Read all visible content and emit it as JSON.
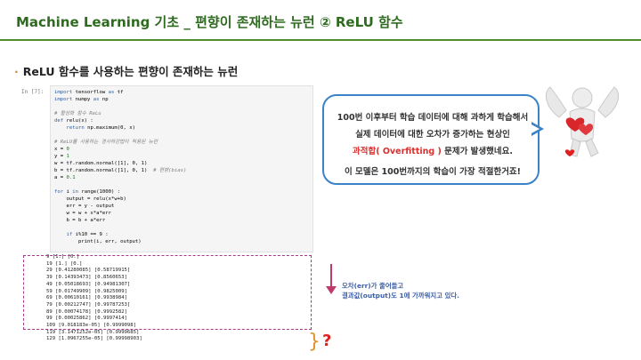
{
  "slide": {
    "title": "Machine Learning 기초 _ 편향이 존재하는 뉴런 ② ReLU 함수",
    "section_bullet": "·",
    "section_heading": "ReLU 함수를 사용하는 편향이 존재하는 뉴런"
  },
  "notebook": {
    "prompt": "In [7]:",
    "code_lines": [
      [
        {
          "t": "import",
          "c": "kw"
        },
        {
          "t": " tensorflow "
        },
        {
          "t": "as",
          "c": "kw"
        },
        {
          "t": " tf"
        }
      ],
      [
        {
          "t": "import",
          "c": "kw"
        },
        {
          "t": " numpy "
        },
        {
          "t": "as",
          "c": "kw"
        },
        {
          "t": " np"
        }
      ],
      [],
      [
        {
          "t": "# 활성화 함수 ReLu",
          "c": "cm"
        }
      ],
      [
        {
          "t": "def",
          "c": "kw"
        },
        {
          "t": " relu(x) :"
        }
      ],
      [
        {
          "t": "    "
        },
        {
          "t": "return",
          "c": "kw"
        },
        {
          "t": " np.maximum(0, x)"
        }
      ],
      [],
      [
        {
          "t": "# ReLU를 사용하는 경사하강법이 적용된 뉴런",
          "c": "cm"
        }
      ],
      [
        {
          "t": "x = "
        },
        {
          "t": "0",
          "c": "nm"
        }
      ],
      [
        {
          "t": "y = "
        },
        {
          "t": "1",
          "c": "nm"
        }
      ],
      [
        {
          "t": "w = tf.random.normal([1], 0, 1)"
        }
      ],
      [
        {
          "t": "b = tf.random.normal([1], 0, 1)  "
        },
        {
          "t": "# 편향(bias)",
          "c": "cm"
        }
      ],
      [
        {
          "t": "a = "
        },
        {
          "t": "0.1",
          "c": "nm"
        }
      ],
      [],
      [
        {
          "t": "for",
          "c": "kw"
        },
        {
          "t": " i "
        },
        {
          "t": "in",
          "c": "kw"
        },
        {
          "t": " range(1000) :"
        }
      ],
      [
        {
          "t": "    output = relu(x*w+b)"
        }
      ],
      [
        {
          "t": "    err = y - output"
        }
      ],
      [
        {
          "t": "    w = w + x*a*err"
        }
      ],
      [
        {
          "t": "    b = b + a*err"
        }
      ],
      [],
      [
        {
          "t": "    "
        },
        {
          "t": "if",
          "c": "kw"
        },
        {
          "t": " i%10 == 9 :"
        }
      ],
      [
        {
          "t": "        print(i, err, output)"
        }
      ]
    ],
    "output_lines": [
      "9 [1.] [0.]",
      "19 [1.] [0.]",
      "29 [0.41280085] [0.58719915]",
      "39 [0.14393473] [0.8560653]",
      "49 [0.05018693] [0.94981307]",
      "59 [0.01749909] [0.9825009]",
      "69 [0.00610161] [0.9938984]",
      "79 [0.00212747] [0.99787253]",
      "89 [0.00074178] [0.9992582]",
      "99 [0.00025862] [0.9997414]",
      "109 [9.018183e-05] [0.9999098]",
      "119 [3.1471252e-05] [0.9999685]",
      "129 [1.0967255e-05] [0.99998903]"
    ]
  },
  "callout": {
    "line1": "100번 이후부터 학습 데이터에 대해 과하게 학습해서",
    "line2": "실제 데이터에 대한 오차가 증가하는 현상인",
    "line3_highlight": "과적합( Overfitting )",
    "line3_rest": " 문제가 발생했네요.",
    "line4": "이 모델은 100번까지의 학습이 가장 적절한거죠!"
  },
  "annotation": {
    "line1": "오차(err)가 줄어들고",
    "line2": "결과값(output)도 1에 가까워지고 있다.",
    "question": "?"
  },
  "colors": {
    "title": "#2e6b1f",
    "title_rule": "#4f8f2a",
    "bubble_border": "#3c82c9",
    "highlight": "#d9302f",
    "dashed_box": "#a83a8a",
    "arrow": "#c0396a",
    "note": "#3a5ea8",
    "brace": "#e0932a",
    "question": "#e02020"
  },
  "icons": {
    "cupid": "cupid-with-hearts-icon"
  }
}
